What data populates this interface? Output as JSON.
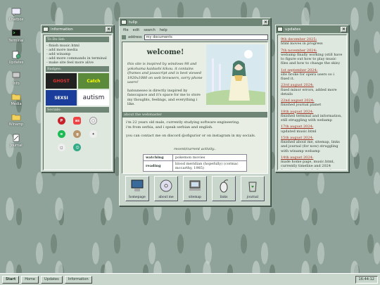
{
  "desktop_icons": [
    {
      "label": "Chatbox"
    },
    {
      "label": "Terminal"
    },
    {
      "label": "Updates"
    },
    {
      "label": "Info"
    },
    {
      "label": "Media"
    },
    {
      "label": "Winamp"
    },
    {
      "label": "Journal"
    }
  ],
  "info_window": {
    "title": "information",
    "todo_header": "To Do list:",
    "todo": [
      "- finish music.html",
      "- add more media",
      "- add winamp",
      "- add more commands in terminal",
      "- make site feel more alive"
    ],
    "badges_header": "Badges:",
    "badges": [
      "GHOST",
      "Catch",
      "SEXSI",
      "autism"
    ],
    "socials_header": "Socials:",
    "socials": [
      "pinterest",
      "last.fm",
      "letterboxd",
      "spotify",
      "goodreads",
      "github",
      "bandcamp",
      "discord"
    ]
  },
  "main_window": {
    "title": "tulip",
    "menu": [
      "file",
      "edit",
      "search",
      "help"
    ],
    "address_label": "address",
    "address_value": "my documents",
    "welcome": "welcome!",
    "intro": [
      "this site is inspired by windows 98 and yokohama kaidashi kikou. it contains iframes and javascript and is best viewed 1920x1080 on web browsers, sorry phone users!",
      "hatsuneseo is directly inspired by fanscapace and it's space for me to store my thoughts, feelings, and everything i like."
    ],
    "about_header": "about the webmaster",
    "about": [
      "i'm 22 years old male, currently studying software engineering.",
      "i'm from serbia, and i speak serbian and english.",
      "you can contact me on discord @ofigurior or on instagram in my socials."
    ],
    "activity_title": "recent/current activity..",
    "activity": [
      {
        "k": "watching",
        "v": "pokemon movies"
      },
      {
        "k": "reading",
        "v": "blood meridian (hopefully) (cormac mccarthy, 1985)"
      }
    ],
    "dock": [
      "homepage",
      "about me",
      "sitemap",
      "links",
      "journal"
    ]
  },
  "updates_window": {
    "title": "updates",
    "items": [
      {
        "date": "9th december 2025:",
        "text": "html moves in progress"
      },
      {
        "date": "7th november 2024:",
        "text": "webamp finally working (still have to figure out how to play music files and how to change the skin)"
      },
      {
        "date": "1st september 2024:",
        "text": "site broke for opera users so i fixed it."
      },
      {
        "date": "23rd august 2024:",
        "text": "fixed minor errors, added more details"
      },
      {
        "date": "22nd august 2024:",
        "text": "finished journal planet"
      },
      {
        "date": "18th august 2024:",
        "text": "finished terminal and information, still struggling with webamp"
      },
      {
        "date": "17th august 2024:",
        "text": "updated music.html"
      },
      {
        "date": "15th august 2024:",
        "text": "finished about me, sitemap, links and journal (for now) struggling with winamp webamp"
      },
      {
        "date": "14th august 2024:",
        "text": "made home page, music.html, currently timeline and 2024 favorites. made chatbox and updates page. also added socials"
      }
    ]
  },
  "taskbar": {
    "start": "Start",
    "buttons": [
      "Home",
      "Updates",
      "Information"
    ],
    "clock": "16:44:12"
  }
}
